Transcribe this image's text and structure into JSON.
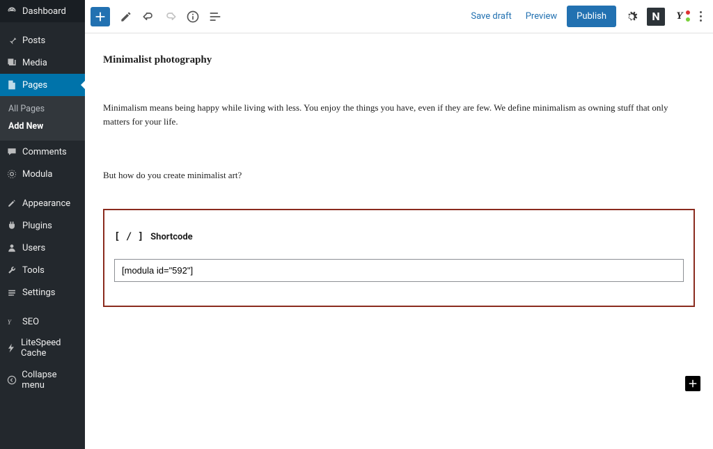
{
  "sidebar": {
    "items": [
      {
        "label": "Dashboard"
      },
      {
        "label": "Posts"
      },
      {
        "label": "Media"
      },
      {
        "label": "Pages"
      },
      {
        "label": "Comments"
      },
      {
        "label": "Modula"
      },
      {
        "label": "Appearance"
      },
      {
        "label": "Plugins"
      },
      {
        "label": "Users"
      },
      {
        "label": "Tools"
      },
      {
        "label": "Settings"
      },
      {
        "label": "SEO"
      },
      {
        "label": "LiteSpeed Cache"
      }
    ],
    "sub": {
      "all": "All Pages",
      "add": "Add New"
    },
    "collapse": "Collapse menu"
  },
  "toolbar": {
    "save_draft": "Save draft",
    "preview": "Preview",
    "publish": "Publish",
    "n_label": "N",
    "y_label": "Y"
  },
  "post": {
    "title": "Minimalist photography",
    "p1": "Minimalism means being happy while living with less. You enjoy the things you have, even if they are few. We define minimalism as owning stuff that only matters for your life.",
    "p2": "But how do you create minimalist art?"
  },
  "shortcode": {
    "icon_text": "[ / ]",
    "label": "Shortcode",
    "value": "[modula id=\"592\"]"
  }
}
